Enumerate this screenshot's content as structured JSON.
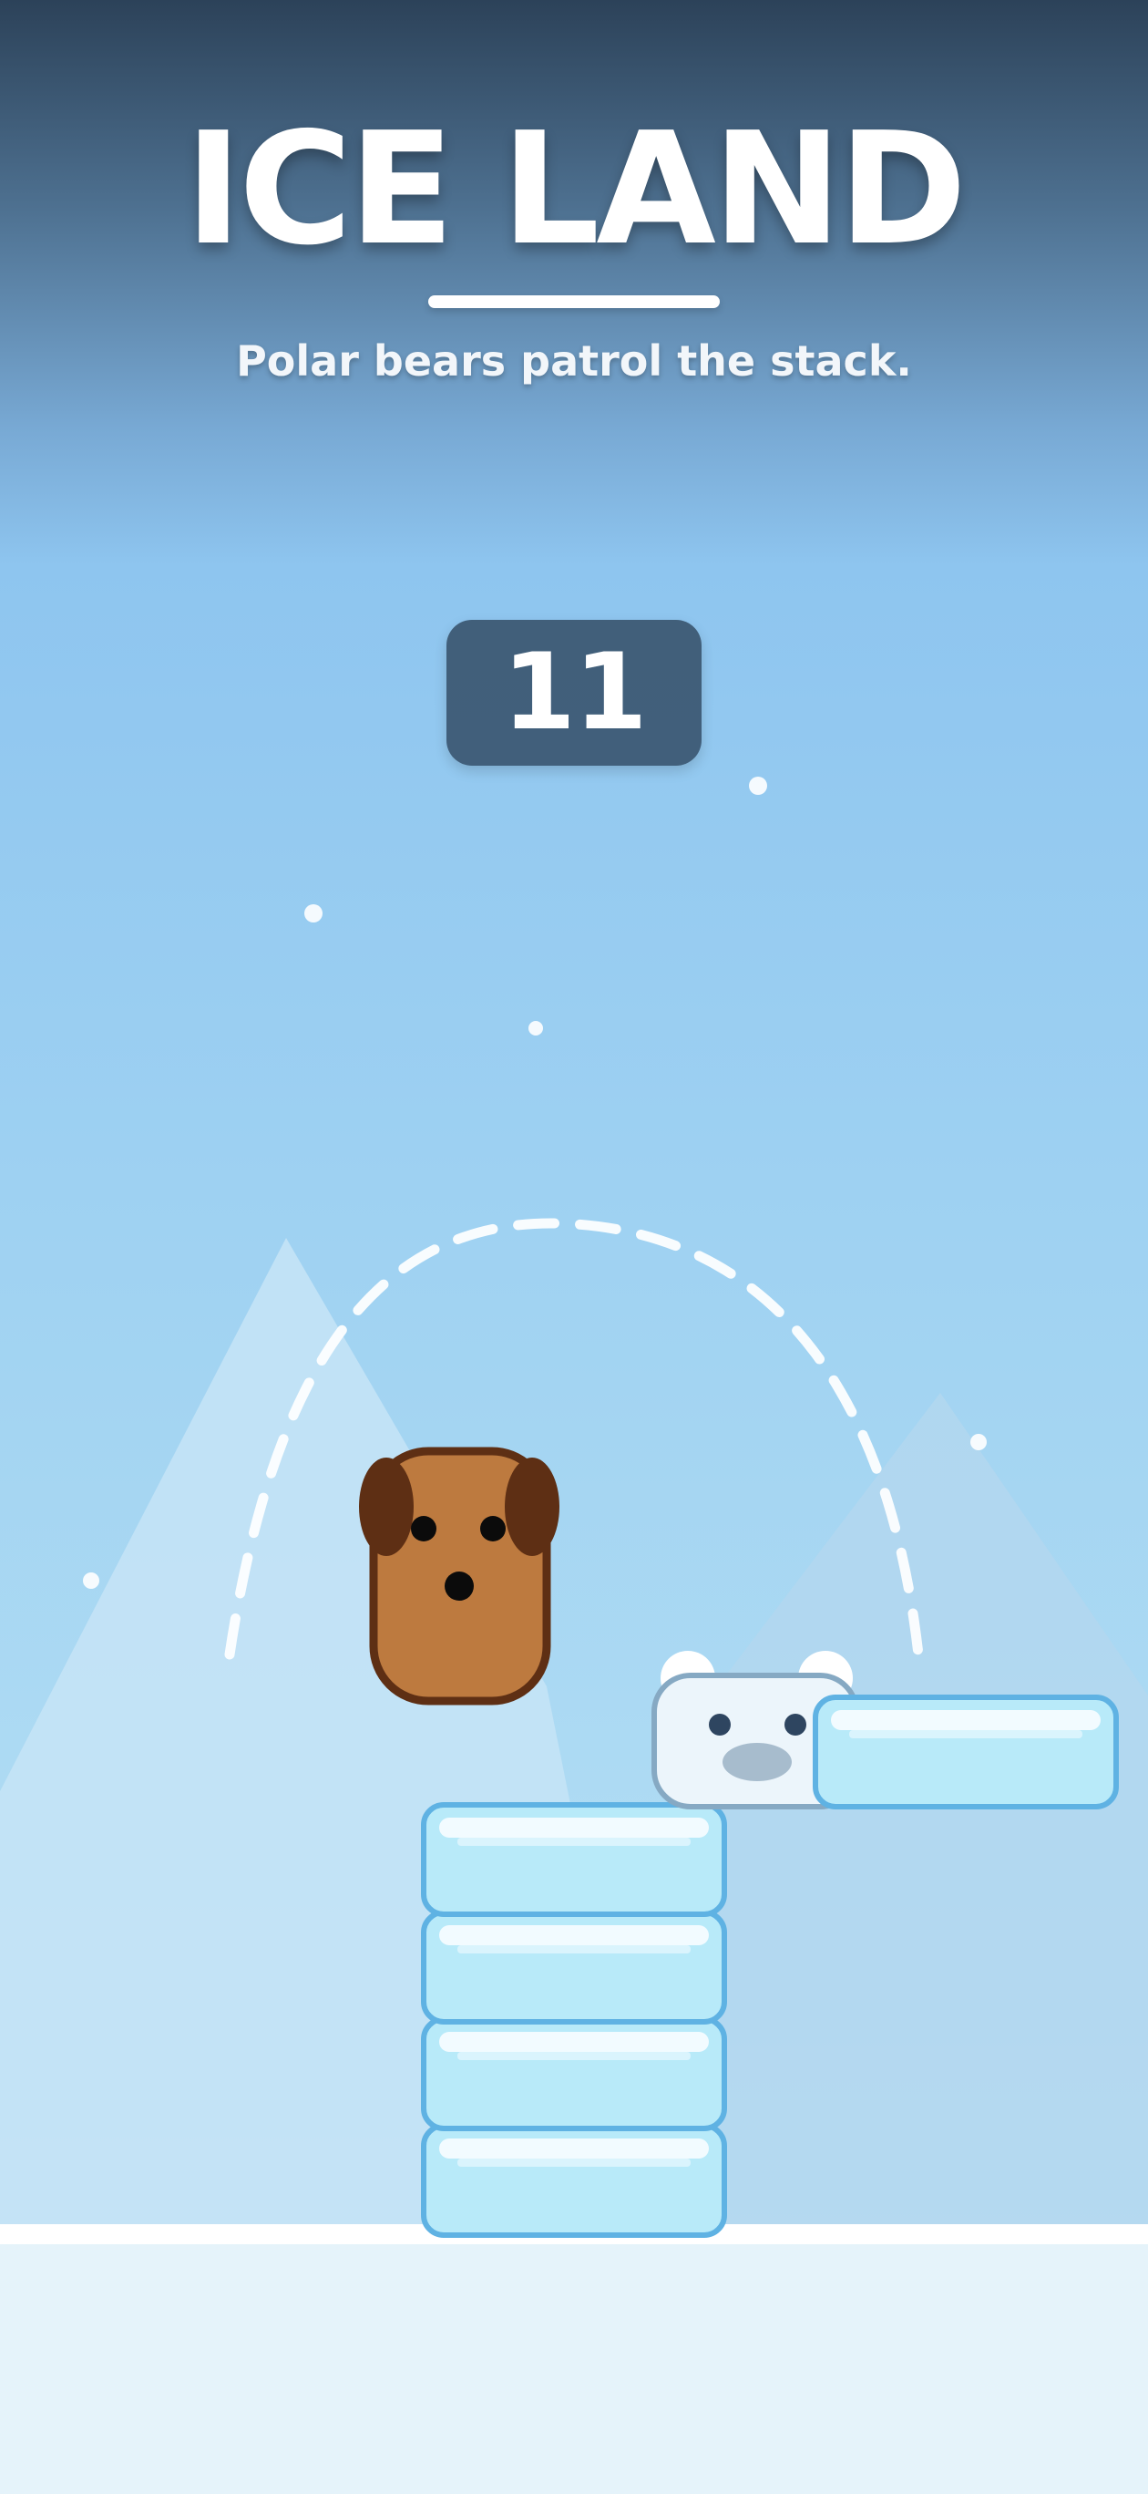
{
  "title": "ICE LAND",
  "subtitle": "Polar bears patrol the stack.",
  "score": "11",
  "colors": {
    "sky_top": "#2c4259",
    "sky_bottom": "#bfe2f4",
    "ice_block_fill": "#b8eaf9",
    "ice_block_border": "#5fb2e3",
    "ground": "#e5f3fa",
    "dog_body": "#bd7a3f",
    "dog_ear": "#5e2f14",
    "bear_body": "#ecf5fb"
  },
  "icons": [
    "dog-player",
    "polar-bear-enemy",
    "ice-block",
    "mountain",
    "snowflake",
    "jump-arc"
  ],
  "stack_height": 4
}
